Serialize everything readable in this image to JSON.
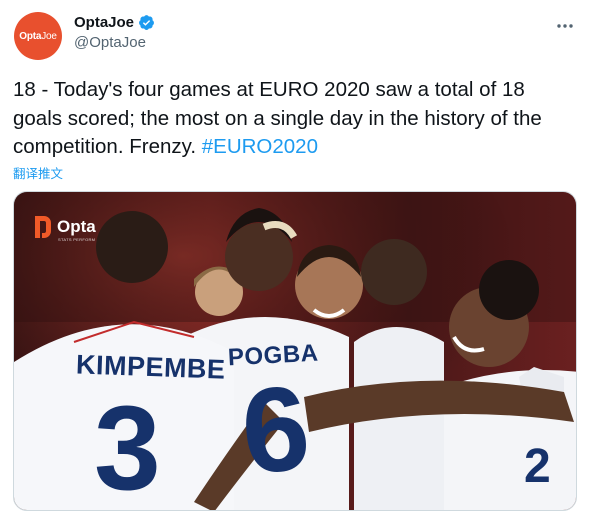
{
  "tweet": {
    "display_name": "OptaJoe",
    "handle": "@OptaJoe",
    "avatar_text_bold": "Opta",
    "avatar_text_thin": "Joe",
    "text_main": "18 - Today's four games at EURO 2020 saw a total of 18 goals scored; the most on a single day in the history of the competition. Frenzy. ",
    "hashtag": "#EURO2020",
    "translate_label": "翻译推文"
  },
  "media": {
    "logo_word": "Opta",
    "logo_sub": "STATS PERFORM",
    "shirt_left_name": "KIMPEMBE",
    "shirt_left_number": "3",
    "shirt_center_name": "POGBA",
    "shirt_center_number": "6"
  },
  "icons": {
    "verified": "verified-badge-icon",
    "more": "more-dots-icon"
  },
  "colors": {
    "avatar_bg": "#e8502e",
    "link": "#1d9bf0",
    "shirt_navy": "#16326b",
    "verified": "#1d9bf0"
  }
}
